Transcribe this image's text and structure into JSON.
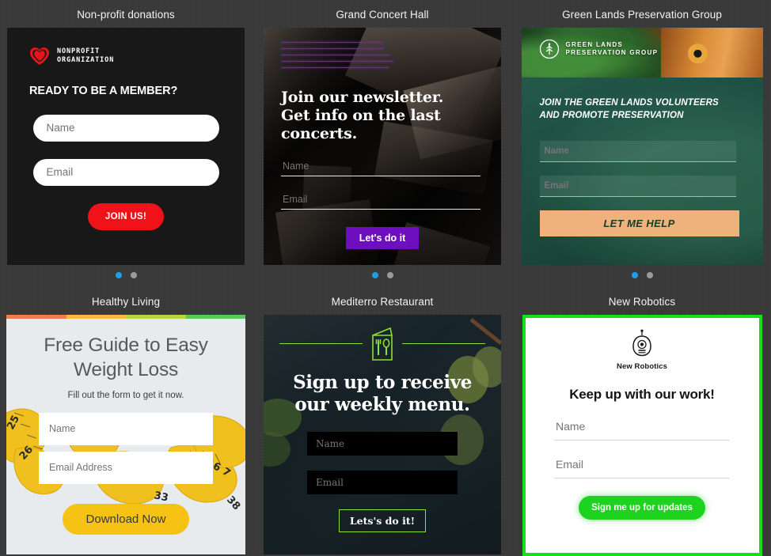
{
  "gallery": {
    "cards": [
      {
        "title": "Non-profit donations",
        "logo_line1": "NONPROFIT",
        "logo_line2": "ORGANIZATION",
        "logo_icon": "heart-icon",
        "heading": "READY TO BE A MEMBER?",
        "name_placeholder": "Name",
        "name_value": "",
        "email_placeholder": "Email",
        "email_value": "",
        "button_label": "JOIN US!",
        "accent_color": "#f01119",
        "background_color": "#181818",
        "dots": [
          {
            "active": true
          },
          {
            "active": false
          }
        ]
      },
      {
        "title": "Grand Concert Hall",
        "decor_lines": 5,
        "heading": "Join our newsletter. Get info on the last concerts.",
        "heading_l1": "Join our newsletter.",
        "heading_l2": "Get info on the last",
        "heading_l3": "concerts.",
        "name_placeholder": "Name",
        "name_value": "",
        "email_placeholder": "Email",
        "email_value": "",
        "button_label": "Let's do it",
        "accent_color": "#6d0fbe",
        "line_color": "#8b12d4",
        "dots": [
          {
            "active": true
          },
          {
            "active": false
          }
        ]
      },
      {
        "title": "Green Lands Preservation Group",
        "logo_icon": "tree-in-circle-icon",
        "logo_line1": "GREEN LANDS",
        "logo_line2": "PRESERVATION GROUP",
        "heading_l1": "JOIN THE GREEN LANDS VOLUNTEERS",
        "heading_l2": "AND PROMOTE PRESERVATION",
        "name_placeholder": "Name",
        "name_value": "",
        "email_placeholder": "Email",
        "email_value": "",
        "button_label": "LET ME HELP",
        "accent_color": "#f0b27c",
        "background_color": "#1f5140",
        "dots": [
          {
            "active": true
          },
          {
            "active": false
          }
        ]
      },
      {
        "title": "Healthy Living",
        "topbar_colors": [
          "#f07a56",
          "#f5bb3c",
          "#b8d63c",
          "#5cc55c"
        ],
        "heading_l1": "Free Guide to Easy",
        "heading_l2": "Weight Loss",
        "subheading": "Fill out the form to get it now.",
        "name_placeholder": "Name",
        "name_value": "",
        "email_placeholder": "Email Address",
        "email_value": "",
        "button_label": "Download Now",
        "accent_color": "#f6c214",
        "background_color": "#e7ebee"
      },
      {
        "title": "Mediterro Restaurant",
        "logo_icon": "menu-card-fork-spoon-icon",
        "heading_l1": "Sign up to receive",
        "heading_l2": "our weekly menu.",
        "name_placeholder": "Name",
        "name_value": "",
        "email_placeholder": "Email",
        "email_value": "",
        "button_label": "Lets's do it!",
        "accent_color": "#8ce037"
      },
      {
        "title": "New Robotics",
        "logo_icon": "robot-head-icon",
        "logo_text": "New Robotics",
        "heading": "Keep up with our work!",
        "name_placeholder": "Name",
        "name_value": "",
        "email_placeholder": "Email",
        "email_value": "",
        "button_label": "Sign me up for updates",
        "accent_color": "#1ed320",
        "border_color": "#18e018",
        "background_color": "#ffffff"
      }
    ]
  }
}
